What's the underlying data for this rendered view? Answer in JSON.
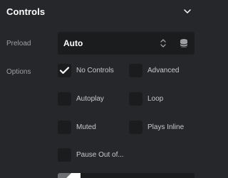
{
  "section": {
    "title": "Controls"
  },
  "preload": {
    "label": "Preload",
    "value": "Auto"
  },
  "options": {
    "label": "Options",
    "items": [
      {
        "label": "No Controls",
        "checked": true
      },
      {
        "label": "Advanced",
        "checked": false
      },
      {
        "label": "Autoplay",
        "checked": false
      },
      {
        "label": "Loop",
        "checked": false
      },
      {
        "label": "Muted",
        "checked": false
      },
      {
        "label": "Plays Inline",
        "checked": false
      },
      {
        "label": "Pause Out of...",
        "checked": false
      }
    ]
  },
  "colors": {
    "background": "#25272a",
    "control_bg": "#1b1c1e",
    "title": "#ffffff",
    "label": "#9ea0a3",
    "text": "#c8c9cb"
  }
}
